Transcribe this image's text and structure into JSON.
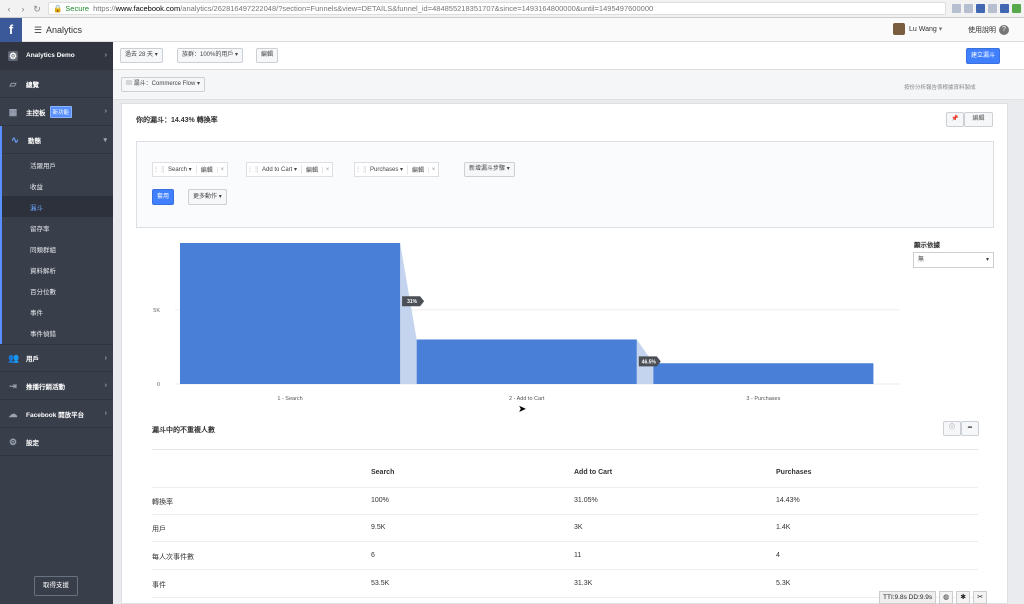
{
  "browser": {
    "secure_label": "Secure",
    "url_scheme": "https://",
    "url_host": "www.facebook.com",
    "url_path": "/analytics/262816497222048/?section=Funnels&view=DETAILS&funnel_id=484855218351707&since=1493164800000&until=1495497600000"
  },
  "topbar": {
    "app_title": "Analytics",
    "user_name": "Lu Wang",
    "help_label": "使用說明"
  },
  "sidebar": {
    "demo_label": "Analytics Demo",
    "items": [
      {
        "label": "總覽"
      },
      {
        "label": "主控板",
        "badge": "新功能"
      },
      {
        "label": "動態"
      }
    ],
    "sub_items": [
      "活躍用戶",
      "收益",
      "漏斗",
      "留存率",
      "同類群組",
      "資料解析",
      "百分位數",
      "事件",
      "事件偵錯"
    ],
    "bottom_items": [
      "用戶",
      "推播行銷活動",
      "Facebook 開放平台",
      "設定"
    ],
    "footer_button": "取得支援"
  },
  "header": {
    "range_button": "過去 28 天",
    "segment_button": "族群：100%的用戶",
    "edit_button": "編輯",
    "create_button": "建立漏斗"
  },
  "funnel_select": {
    "label": "漏斗：Commerce Flow"
  },
  "hint": "按份分析報告係根據資料製成",
  "panel": {
    "title": "你的漏斗：14.43% 轉換率",
    "edit_label": "編輯",
    "apply_label": "套用",
    "more_actions_label": "更多動作",
    "add_step_label": "新增漏斗步驟",
    "steps": [
      {
        "label": "Search",
        "edit": "編輯"
      },
      {
        "label": "Add to Cart",
        "edit": "編輯"
      },
      {
        "label": "Purchases",
        "edit": "編輯"
      }
    ]
  },
  "show_basis": {
    "label": "顯示依據",
    "value": "無"
  },
  "chart_data": {
    "type": "bar",
    "categories": [
      "1 - Search",
      "2 - Add to Cart",
      "3 - Purchases"
    ],
    "values": [
      9500,
      3000,
      1400
    ],
    "ylim": [
      0,
      9500
    ],
    "ytick_labels": [
      "0",
      "5K"
    ],
    "yticks": [
      0,
      5000
    ],
    "conversion_labels": [
      "31%",
      "46.5%"
    ],
    "bar_color": "#4a7fd7",
    "connector_color": "#c4d4ee"
  },
  "table": {
    "title": "漏斗中的不重複人數",
    "columns": [
      "",
      "Search",
      "Add to Cart",
      "Purchases"
    ],
    "rows": [
      [
        "轉換率",
        "100%",
        "31.05%",
        "14.43%"
      ],
      [
        "用戶",
        "9.5K",
        "3K",
        "1.4K"
      ],
      [
        "每人次事件數",
        "6",
        "11",
        "4"
      ],
      [
        "事件",
        "53.5K",
        "31.3K",
        "5.3K"
      ]
    ]
  },
  "perf": {
    "text": "TTI:9.8s DD:9.9s"
  }
}
